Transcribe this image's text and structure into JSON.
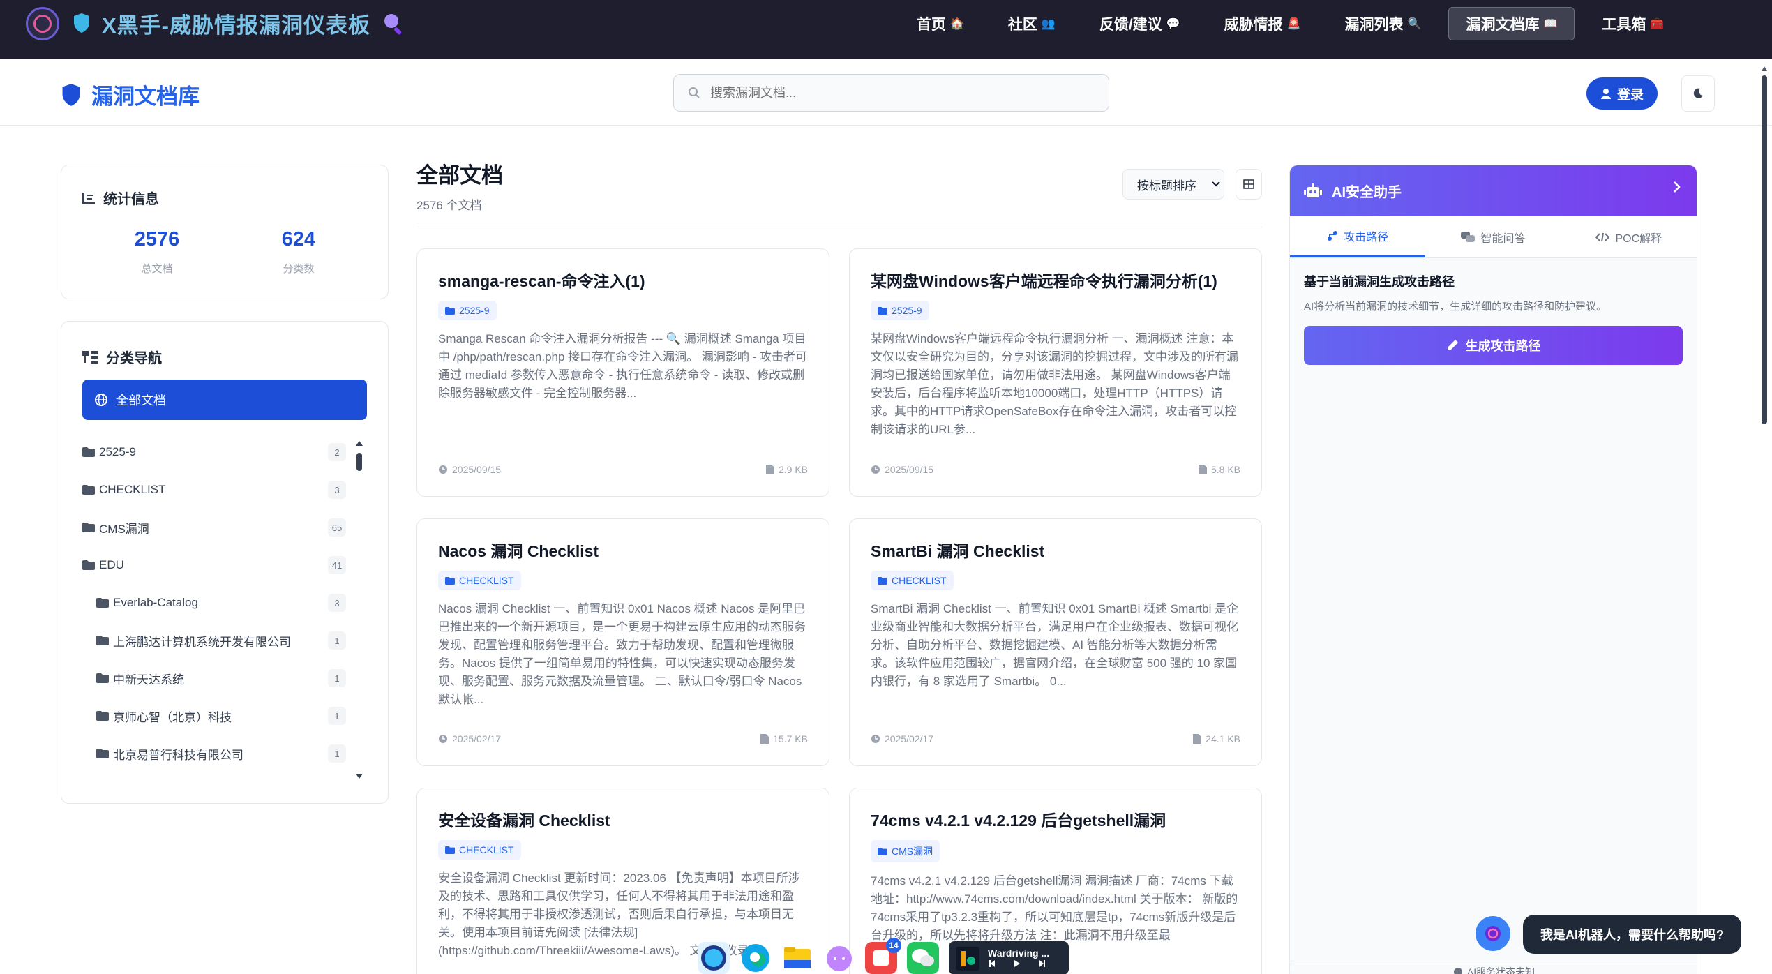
{
  "topbar": {
    "title": "X黑手-威胁情报漏洞仪表板",
    "nav": [
      {
        "label": "首页",
        "emoji": "🏠"
      },
      {
        "label": "社区",
        "emoji": "👥"
      },
      {
        "label": "反馈/建议",
        "emoji": "💬"
      },
      {
        "label": "威胁情报",
        "emoji": "🚨"
      },
      {
        "label": "漏洞列表",
        "emoji": "🔍"
      },
      {
        "label": "漏洞文档库",
        "emoji": "📖",
        "active": true
      },
      {
        "label": "工具箱",
        "emoji": "🧰"
      }
    ]
  },
  "subheader": {
    "title": "漏洞文档库",
    "search_placeholder": "搜索漏洞文档...",
    "login_label": "登录"
  },
  "stats": {
    "heading": "统计信息",
    "total_docs": "2576",
    "total_docs_label": "总文档",
    "categories": "624",
    "categories_label": "分类数"
  },
  "catnav": {
    "heading": "分类导航",
    "all_label": "全部文档",
    "items": [
      {
        "label": "2525-9",
        "count": "2",
        "indent": false
      },
      {
        "label": "CHECKLIST",
        "count": "3",
        "indent": false
      },
      {
        "label": "CMS漏洞",
        "count": "65",
        "indent": false
      },
      {
        "label": "EDU",
        "count": "41",
        "indent": false
      },
      {
        "label": "Everlab-Catalog",
        "count": "3",
        "indent": true
      },
      {
        "label": "上海鹏达计算机系统开发有限公司",
        "count": "1",
        "indent": true
      },
      {
        "label": "中新天达系统",
        "count": "1",
        "indent": true
      },
      {
        "label": "京师心智（北京）科技",
        "count": "1",
        "indent": true
      },
      {
        "label": "北京易普行科技有限公司",
        "count": "1",
        "indent": true
      }
    ]
  },
  "main": {
    "title": "全部文档",
    "count_text": "2576 个文档",
    "sort_label": "按标题排序"
  },
  "docs": [
    {
      "title": "smanga-rescan-命令注入(1)",
      "tag": "2525-9",
      "desc": "Smanga Rescan 命令注入漏洞分析报告 --- 🔍 漏洞概述 Smanga 项目中 /php/path/rescan.php 接口存在命令注入漏洞。 漏洞影响 - 攻击者可通过 mediaId 参数传入恶意命令 - 执行任意系统命令 - 读取、修改或删除服务器敏感文件 - 完全控制服务器...",
      "date": "2025/09/15",
      "size": "2.9 KB"
    },
    {
      "title": "某网盘Windows客户端远程命令执行漏洞分析(1)",
      "tag": "2525-9",
      "desc": "某网盘Windows客户端远程命令执行漏洞分析 一、漏洞概述 注意：本文仅以安全研究为目的，分享对该漏洞的挖掘过程，文中涉及的所有漏洞均已报送给国家单位，请勿用做非法用途。 某网盘Windows客户端安装后，后台程序将监听本地10000端口，处理HTTP（HTTPS）请求。其中的HTTP请求OpenSafeBox存在命令注入漏洞，攻击者可以控制该请求的URL参...",
      "date": "2025/09/15",
      "size": "5.8 KB"
    },
    {
      "title": "Nacos 漏洞 Checklist",
      "tag": "CHECKLIST",
      "desc": "Nacos 漏洞 Checklist 一、前置知识 0x01 Nacos 概述 Nacos 是阿里巴巴推出来的一个新开源项目，是一个更易于构建云原生应用的动态服务发现、配置管理和服务管理平台。致力于帮助发现、配置和管理微服务。Nacos 提供了一组简单易用的特性集，可以快速实现动态服务发现、服务配置、服务元数据及流量管理。 二、默认口令/弱口令 Nacos 默认帐...",
      "date": "2025/02/17",
      "size": "15.7 KB"
    },
    {
      "title": "SmartBi 漏洞 Checklist",
      "tag": "CHECKLIST",
      "desc": "SmartBi 漏洞 Checklist 一、前置知识 0x01 SmartBi 概述 Smartbi 是企业级商业智能和大数据分析平台，满足用户在企业级报表、数据可视化分析、自助分析平台、数据挖掘建模、AI 智能分析等大数据分析需求。该软件应用范围较广，据官网介绍，在全球财富 500 强的 10 家国内银行，有 8 家选用了 Smartbi。 0...",
      "date": "2025/02/17",
      "size": "24.1 KB"
    },
    {
      "title": "安全设备漏洞 Checklist",
      "tag": "CHECKLIST",
      "desc": "安全设备漏洞 Checklist 更新时间：2023.06 【免责声明】本项目所涉及的技术、思路和工具仅供学习，任何人不得将其用于非法用途和盈利，不得将其用于非授权渗透测试，否则后果自行承担，与本项目无关。使用本项目前请先阅读 [法律法规](https://github.com/Threekiii/Awesome-Laws)。 文档已收录 [",
      "date": "",
      "size": ""
    },
    {
      "title": "74cms v4.2.1 v4.2.129 后台getshell漏洞",
      "tag": "CMS漏洞",
      "desc": "74cms v4.2.1 v4.2.129 后台getshell漏洞 漏洞描述 厂商：74cms 下载地址：http://www.74cms.com/download/index.html 关于版本： 新版的74cms采用了tp3.2.3重构了，所以可知底层是tp，74cms新版升级是后台升级的，所以先将将升级方法 注：此漏洞不用升级至最",
      "date": "",
      "size": ""
    }
  ],
  "ai": {
    "title": "AI安全助手",
    "tabs": [
      "攻击路径",
      "智能问答",
      "POC解释"
    ],
    "heading": "基于当前漏洞生成攻击路径",
    "desc": "AI将分析当前漏洞的技术细节，生成详细的攻击路径和防护建议。",
    "button": "生成攻击路径",
    "status": "AI服务状态未知",
    "bubble": "我是AI机器人，需要什么帮助吗?"
  },
  "dock": {
    "badge": "14",
    "mini_title": "Wardriving ..."
  }
}
